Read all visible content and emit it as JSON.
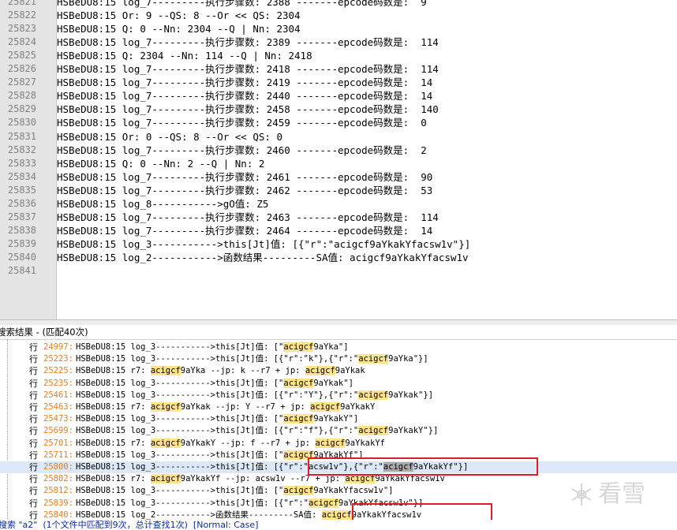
{
  "editor": {
    "lines": [
      {
        "num": "25821",
        "text": "HSBeDU8:15 log_7---------执行步骤数: 2388 -------epcode码数是:  9"
      },
      {
        "num": "25822",
        "text": "HSBeDU8:15 Or: 9 --QS: 8 --Or << QS: 2304"
      },
      {
        "num": "25823",
        "text": "HSBeDU8:15 Q: 0 --Nn: 2304 --Q | Nn: 2304"
      },
      {
        "num": "25824",
        "text": "HSBeDU8:15 log_7---------执行步骤数: 2389 -------epcode码数是:  114"
      },
      {
        "num": "25825",
        "text": "HSBeDU8:15 Q: 2304 --Nn: 114 --Q | Nn: 2418"
      },
      {
        "num": "25826",
        "text": "HSBeDU8:15 log_7---------执行步骤数: 2418 -------epcode码数是:  114"
      },
      {
        "num": "25827",
        "text": "HSBeDU8:15 log_7---------执行步骤数: 2419 -------epcode码数是:  14"
      },
      {
        "num": "25828",
        "text": "HSBeDU8:15 log_7---------执行步骤数: 2440 -------epcode码数是:  14"
      },
      {
        "num": "25829",
        "text": "HSBeDU8:15 log_7---------执行步骤数: 2458 -------epcode码数是:  140"
      },
      {
        "num": "25830",
        "text": "HSBeDU8:15 log_7---------执行步骤数: 2459 -------epcode码数是:  0"
      },
      {
        "num": "25831",
        "text": "HSBeDU8:15 Or: 0 --QS: 8 --Or << QS: 0"
      },
      {
        "num": "25832",
        "text": "HSBeDU8:15 log_7---------执行步骤数: 2460 -------epcode码数是:  2"
      },
      {
        "num": "25833",
        "text": "HSBeDU8:15 Q: 0 --Nn: 2 --Q | Nn: 2"
      },
      {
        "num": "25834",
        "text": "HSBeDU8:15 log_7---------执行步骤数: 2461 -------epcode码数是:  90"
      },
      {
        "num": "25835",
        "text": "HSBeDU8:15 log_7---------执行步骤数: 2462 -------epcode码数是:  53"
      },
      {
        "num": "25836",
        "text": "HSBeDU8:15 log_8----------->gO值: Z5"
      },
      {
        "num": "25837",
        "text": "HSBeDU8:15 log_7---------执行步骤数: 2463 -------epcode码数是:  114"
      },
      {
        "num": "25838",
        "text": "HSBeDU8:15 log_7---------执行步骤数: 2464 -------epcode码数是:  14"
      },
      {
        "num": "25839",
        "text": "HSBeDU8:15 log_3----------->this[Jt]值: [{\"r\":\"acigcf9aYkakYfacsw1v\"}]"
      },
      {
        "num": "25840",
        "text": "HSBeDU8:15 log_2----------->函数结果---------SA值: acigcf9aYkakYfacsw1v"
      },
      {
        "num": "25841",
        "text": ""
      }
    ]
  },
  "results": {
    "header": "搜索结果 - (匹配40次)",
    "row_prefix": "行",
    "rows": [
      {
        "num": "24997:",
        "parts": [
          "HSBeDU8:15 log_3----------->this[Jt]值: [\"",
          "acigcf",
          "9aYka\"]"
        ]
      },
      {
        "num": "25223:",
        "parts": [
          "HSBeDU8:15 log_3----------->this[Jt]值: [{\"r\":\"k\"},{\"r\":\"",
          "acigcf",
          "9aYka\"}]"
        ]
      },
      {
        "num": "25225:",
        "parts": [
          "HSBeDU8:15 r7: ",
          "acigcf",
          "9aYka --jp: k --r7 + jp: ",
          "acigcf",
          "9aYkak"
        ]
      },
      {
        "num": "25235:",
        "parts": [
          "HSBeDU8:15 log_3----------->this[Jt]值: [\"",
          "acigcf",
          "9aYkak\"]"
        ]
      },
      {
        "num": "25461:",
        "parts": [
          "HSBeDU8:15 log_3----------->this[Jt]值: [{\"r\":\"Y\"},{\"r\":\"",
          "acigcf",
          "9aYkak\"}]"
        ]
      },
      {
        "num": "25463:",
        "parts": [
          "HSBeDU8:15 r7: ",
          "acigcf",
          "9aYkak --jp: Y --r7 + jp: ",
          "acigcf",
          "9aYkakY"
        ]
      },
      {
        "num": "25473:",
        "parts": [
          "HSBeDU8:15 log_3----------->this[Jt]值: [\"",
          "acigcf",
          "9aYkakY\"]"
        ]
      },
      {
        "num": "25699:",
        "parts": [
          "HSBeDU8:15 log_3----------->this[Jt]值: [{\"r\":\"f\"},{\"r\":\"",
          "acigcf",
          "9aYkakY\"}]"
        ]
      },
      {
        "num": "25701:",
        "parts": [
          "HSBeDU8:15 r7: ",
          "acigcf",
          "9aYkakY --jp: f --r7 + jp: ",
          "acigcf",
          "9aYkakYf"
        ]
      },
      {
        "num": "25711:",
        "parts": [
          "HSBeDU8:15 log_3----------->this[Jt]值: [\"",
          "acigcf",
          "9aYkakYf\"]"
        ]
      },
      {
        "num": "25800:",
        "parts": [
          "HSBeDU8:15 log_3----------->this[Jt]值: [{\"r\":\"acsw1v\"},{\"r\":\"",
          "acigcf",
          "9aYkakYf\"}]"
        ]
      },
      {
        "num": "25802:",
        "parts": [
          "HSBeDU8:15 r7: ",
          "acigcf",
          "9aYkakYf --jp: acsw1v --r7 + jp: ",
          "acigcf",
          "9aYkakYfacsw1v"
        ]
      },
      {
        "num": "25812:",
        "parts": [
          "HSBeDU8:15 log_3----------->this[Jt]值: [\"",
          "acigcf",
          "9aYkakYfacsw1v\"]"
        ]
      },
      {
        "num": "25839:",
        "parts": [
          "HSBeDU8:15 log_3----------->this[Jt]值: [{\"r\":\"",
          "acigcf",
          "9aYkakYfacsw1v\"}]"
        ]
      },
      {
        "num": "25840:",
        "parts": [
          "HSBeDU8:15 log_2----------->函数结果---------SA值: ",
          "acigcf",
          "9aYkakYfacsw1v"
        ]
      }
    ],
    "footer": "搜索 \"a2\"  (1个文件中匹配到9次，总计查找1次)  [Normal: Case]"
  },
  "watermark": {
    "text": "看雪"
  },
  "colors": {
    "line_number": "#e67e22",
    "match_highlight": "#ffe38c",
    "selected_match": "#a9a9a9",
    "selected_row": "#dce8f8",
    "annotation_box": "#e01b24"
  }
}
